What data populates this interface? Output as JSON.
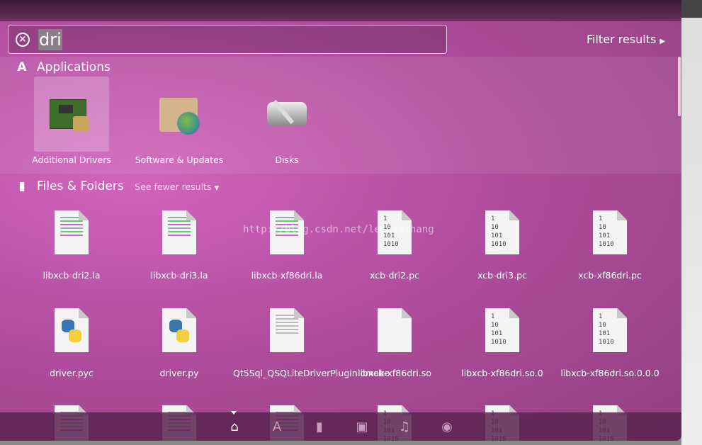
{
  "search": {
    "query": "dri",
    "clear_icon": "clear-circle-icon"
  },
  "filter_label": "Filter results",
  "applications": {
    "heading": "Applications",
    "items": [
      {
        "label": "Additional Drivers",
        "selected": true
      },
      {
        "label": "Software & Updates"
      },
      {
        "label": "Disks"
      }
    ]
  },
  "files": {
    "heading": "Files & Folders",
    "toggle": "See fewer results",
    "items": [
      {
        "label": "libxcb-dri2.la",
        "type": "text"
      },
      {
        "label": "libxcb-dri3.la",
        "type": "text"
      },
      {
        "label": "libxcb-xf86dri.la",
        "type": "text"
      },
      {
        "label": "xcb-dri2.pc",
        "type": "binary"
      },
      {
        "label": "xcb-dri3.pc",
        "type": "binary"
      },
      {
        "label": "xcb-xf86dri.pc",
        "type": "binary"
      },
      {
        "label": "driver.pyc",
        "type": "python"
      },
      {
        "label": "driver.py",
        "type": "python"
      },
      {
        "label": "Qt5Sql_QSQLiteDriverPlugin.cmake",
        "type": "doc"
      },
      {
        "label": "libxcb-xf86dri.so",
        "type": "blank"
      },
      {
        "label": "libxcb-xf86dri.so.0",
        "type": "binary"
      },
      {
        "label": "libxcb-xf86dri.so.0.0.0",
        "type": "binary"
      }
    ]
  },
  "binary_text": [
    "1",
    "10",
    "101",
    "1010"
  ],
  "watermark": "http://blog.csdn.net/leijieZhang",
  "lenses": [
    "home",
    "applications",
    "files",
    "video",
    "music",
    "photos"
  ]
}
